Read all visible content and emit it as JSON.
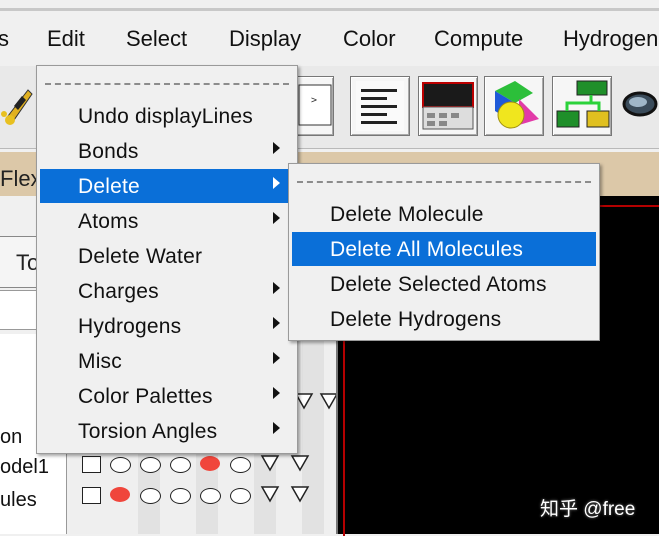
{
  "menubar": {
    "items": [
      "s",
      "Edit",
      "Select",
      "Display",
      "Color",
      "Compute",
      "Hydrogen"
    ]
  },
  "toolbar": {
    "icons": [
      "molecule-tool-icon",
      "terminal-icon",
      "text-lines-icon",
      "window-icon",
      "shapes-icon",
      "flow-diagram-icon",
      "goggles-icon"
    ]
  },
  "strip": {
    "label": "Flex"
  },
  "left_panel": {
    "tab_label": "To",
    "tree": [
      "on",
      "odel1",
      "ules"
    ]
  },
  "edit_menu": {
    "items": [
      {
        "label": "Undo displayLines",
        "submenu": false
      },
      {
        "label": "Bonds",
        "submenu": true
      },
      {
        "label": "Delete",
        "submenu": true,
        "active": true
      },
      {
        "label": "Atoms",
        "submenu": true
      },
      {
        "label": "Delete Water",
        "submenu": false
      },
      {
        "label": "Charges",
        "submenu": true
      },
      {
        "label": "Hydrogens",
        "submenu": true
      },
      {
        "label": "Misc",
        "submenu": true
      },
      {
        "label": "Color Palettes",
        "submenu": true
      },
      {
        "label": "Torsion Angles",
        "submenu": true
      }
    ]
  },
  "delete_submenu": {
    "items": [
      {
        "label": "Delete Molecule"
      },
      {
        "label": "Delete All Molecules",
        "active": true
      },
      {
        "label": "Delete Selected Atoms"
      },
      {
        "label": "Delete Hydrogens"
      }
    ]
  },
  "watermark": "知乎 @free",
  "colors": {
    "highlight": "#0a6fd8",
    "strip": "#dcc8a8",
    "viewer": "#000000",
    "viewer_border": "#b40000",
    "red_dot": "#f0463c"
  }
}
